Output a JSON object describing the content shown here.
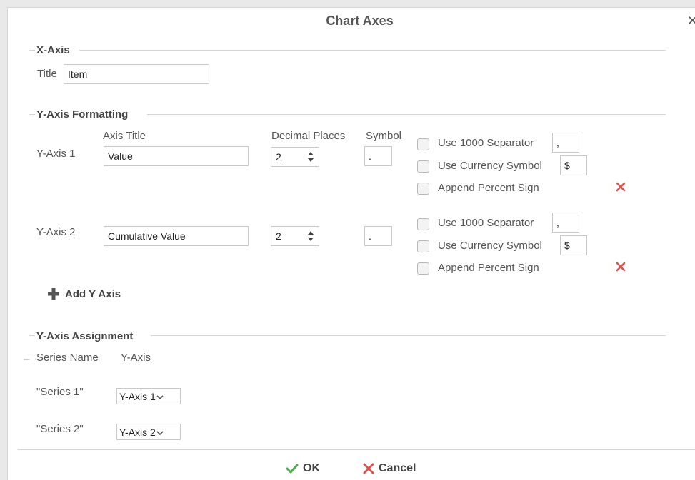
{
  "dialog": {
    "title": "Chart Axes",
    "close_glyph": "✕"
  },
  "x_axis": {
    "section_title": "X-Axis",
    "title_label": "Title",
    "title_value": "Item"
  },
  "y_formatting": {
    "section_title": "Y-Axis Formatting",
    "col_axis_title": "Axis Title",
    "col_decimal_places": "Decimal Places",
    "col_symbol": "Symbol",
    "rows": [
      {
        "label": "Y-Axis 1",
        "axis_title": "Value",
        "decimal_places": "2",
        "symbol": ".",
        "use_1000_label": "Use 1000 Separator",
        "separator": ",",
        "use_currency_label": "Use Currency Symbol",
        "currency": "$",
        "append_percent_label": "Append Percent Sign"
      },
      {
        "label": "Y-Axis 2",
        "axis_title": "Cumulative Value",
        "decimal_places": "2",
        "symbol": ".",
        "use_1000_label": "Use 1000 Separator",
        "separator": ",",
        "use_currency_label": "Use Currency Symbol",
        "currency": "$",
        "append_percent_label": "Append Percent Sign"
      }
    ],
    "add_label": "Add Y Axis"
  },
  "assignment": {
    "section_title": "Y-Axis Assignment",
    "col_series": "Series Name",
    "col_axis": "Y-Axis",
    "rows": [
      {
        "series": "\"Series 1\"",
        "axis": "Y-Axis 1"
      },
      {
        "series": "\"Series 2\"",
        "axis": "Y-Axis 2"
      }
    ]
  },
  "footer": {
    "ok_label": "OK",
    "cancel_label": "Cancel"
  },
  "colors": {
    "delete": "#d9534f",
    "ok": "#4cae4c",
    "cancel": "#d9534f"
  },
  "icons": [
    "close-icon",
    "spinner-arrows-icon",
    "delete-x-icon",
    "plus-icon",
    "chevron-down-icon",
    "checkmark-icon",
    "cancel-x-icon"
  ]
}
